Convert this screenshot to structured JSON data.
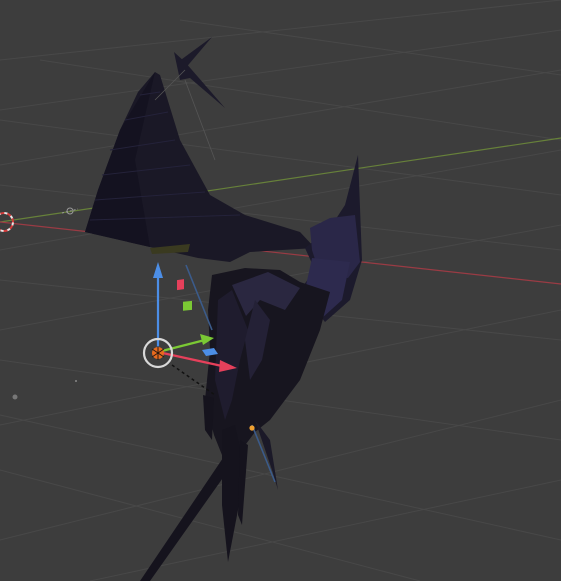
{
  "viewport": {
    "background": "#3d3d3d",
    "grid_color": "#484848",
    "axis_x_color": "#9a3b44",
    "axis_y_color": "#67813a"
  },
  "mesh": {
    "color_dark": "#15131d",
    "color_mid": "#24213a",
    "color_highlight": "#3c3866"
  },
  "gizmo": {
    "z_arrow_color": "#4c8ee6",
    "y_arrow_color": "#7bc934",
    "x_arrow_color": "#e6405b",
    "origin_color": "#e86a1e",
    "pivot_ring_color": "#d8d8d8"
  },
  "icons": {
    "light": "light-icon",
    "origin": "object-origin-icon",
    "cursor": "3d-cursor-icon"
  }
}
